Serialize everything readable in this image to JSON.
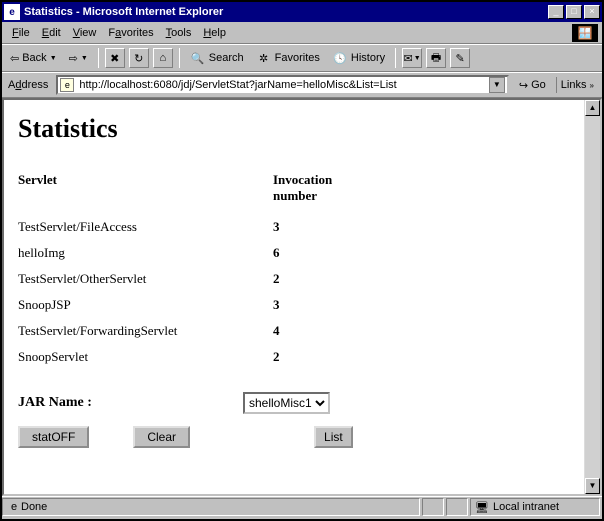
{
  "window": {
    "title": "Statistics - Microsoft Internet Explorer",
    "min": "_",
    "max": "□",
    "close": "×"
  },
  "menubar": {
    "file": "File",
    "edit": "Edit",
    "view": "View",
    "favorites": "Favorites",
    "tools": "Tools",
    "help": "Help"
  },
  "toolbar": {
    "back": "Back",
    "search": "Search",
    "favorites": "Favorites",
    "history": "History"
  },
  "addressbar": {
    "label": "Address",
    "url": "http://localhost:6080/jdj/ServletStat?jarName=helloMisc&List=List",
    "go": "Go",
    "links": "Links"
  },
  "page": {
    "heading": "Statistics",
    "col_servlet": "Servlet",
    "col_invocation_l1": "Invocation",
    "col_invocation_l2": "number",
    "rows": [
      {
        "servlet": "TestServlet/FileAccess",
        "count": "3"
      },
      {
        "servlet": "helloImg",
        "count": "6"
      },
      {
        "servlet": "TestServlet/OtherServlet",
        "count": "2"
      },
      {
        "servlet": "SnoopJSP",
        "count": "3"
      },
      {
        "servlet": "TestServlet/ForwardingServlet",
        "count": "4"
      },
      {
        "servlet": "SnoopServlet",
        "count": "2"
      }
    ],
    "jar_label": "JAR Name :",
    "jar_selected": "shelloMisc1",
    "btn_statoff": "statOFF",
    "btn_clear": "Clear",
    "btn_list": "List"
  },
  "statusbar": {
    "status": "Done",
    "zone": "Local intranet"
  }
}
